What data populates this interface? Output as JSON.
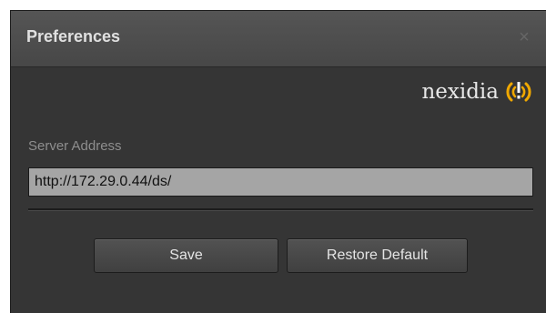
{
  "dialog": {
    "title": "Preferences",
    "close_glyph": "×",
    "close_icon": "close-icon"
  },
  "logo": {
    "text": "nexidia",
    "mark_icon": "nexidia-signal-logo-icon",
    "accent_color": "#f0a800"
  },
  "server": {
    "label": "Server Address",
    "value": "http://172.29.0.44/ds/"
  },
  "buttons": {
    "save_label": "Save",
    "restore_label": "Restore Default"
  }
}
